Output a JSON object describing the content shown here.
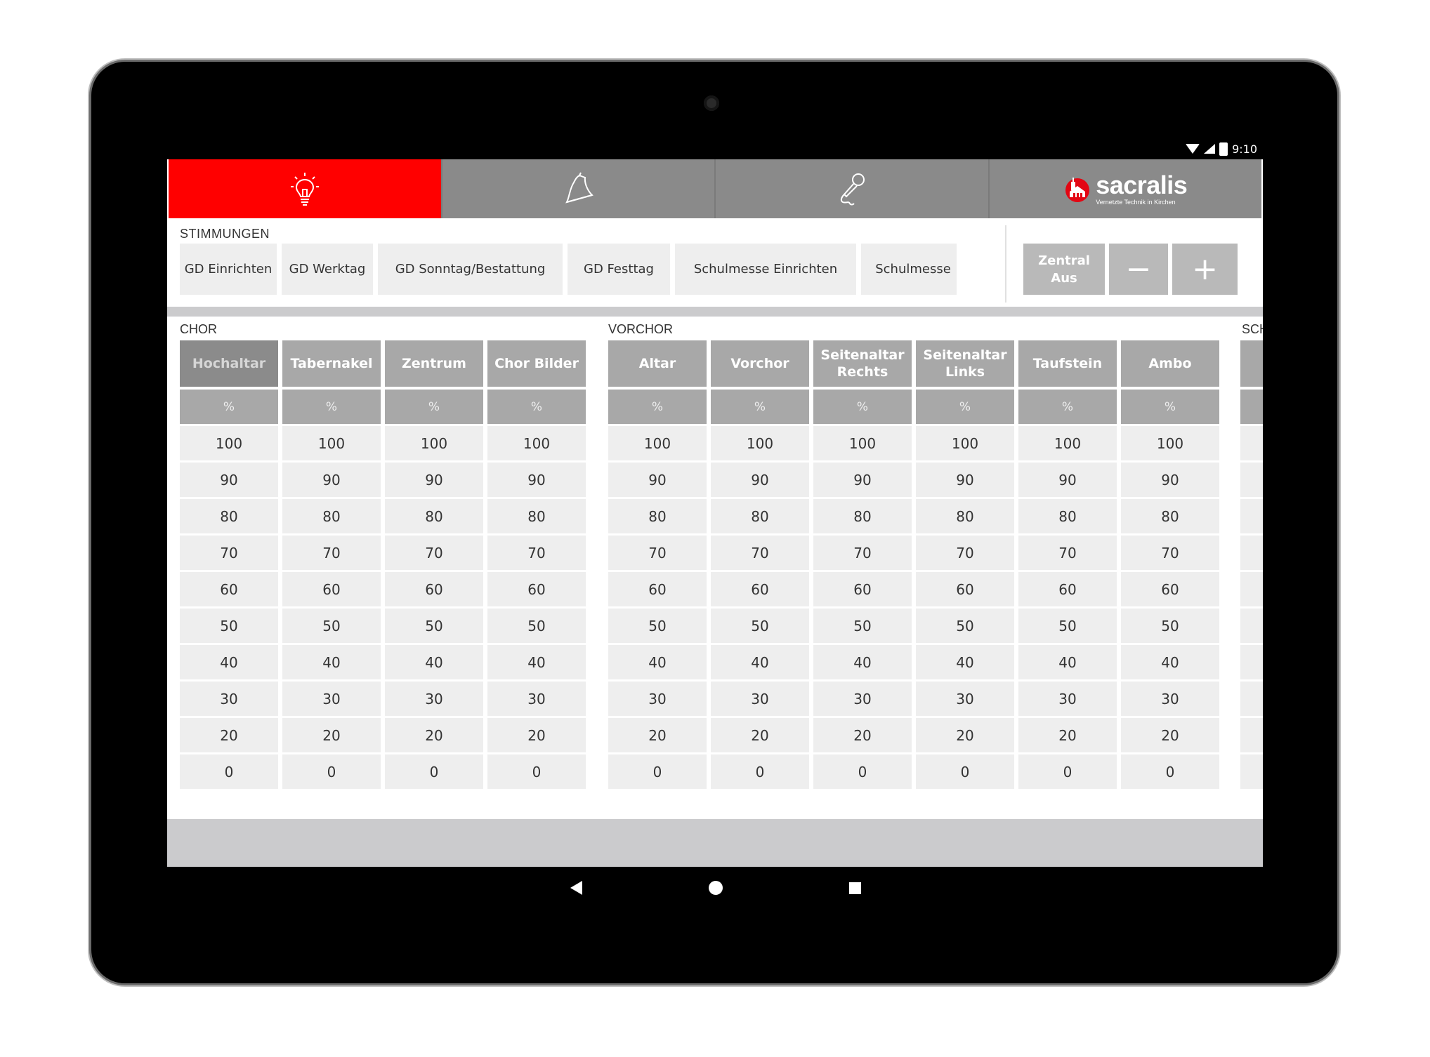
{
  "status": {
    "time": "9:10"
  },
  "nav": {
    "tabs": [
      {
        "name": "light",
        "icon": "lightbulb-icon",
        "active": true
      },
      {
        "name": "bells",
        "icon": "bell-icon",
        "active": false
      },
      {
        "name": "microphone",
        "icon": "microphone-icon",
        "active": false
      },
      {
        "name": "brand",
        "icon": "church-logo-icon",
        "active": false
      }
    ],
    "brand_name": "sacralis",
    "brand_tagline": "Vernetzte Technik in Kirchen"
  },
  "moods": {
    "label": "STIMMUNGEN",
    "items": [
      "GD Einrichten",
      "GD Werktag",
      "GD Sonntag/Bestattung",
      "GD Festtag",
      "Schulmesse Einrichten",
      "Schulmesse"
    ],
    "controls": {
      "zentral_line1": "Zentral",
      "zentral_line2": "Aus",
      "minus": "−",
      "plus": "+"
    }
  },
  "groups": [
    {
      "label": "CHOR",
      "channels": [
        {
          "line1": "Hochaltar",
          "line2": "",
          "selected": true
        },
        {
          "line1": "Tabernakel",
          "line2": ""
        },
        {
          "line1": "Zentrum",
          "line2": ""
        },
        {
          "line1": "Chor Bilder",
          "line2": ""
        }
      ]
    },
    {
      "label": "VORCHOR",
      "channels": [
        {
          "line1": "Altar",
          "line2": ""
        },
        {
          "line1": "Vorchor",
          "line2": ""
        },
        {
          "line1": "Seitenaltar",
          "line2": "Rechts"
        },
        {
          "line1": "Seitenaltar",
          "line2": "Links"
        },
        {
          "line1": "Taufstein",
          "line2": ""
        },
        {
          "line1": "Ambo",
          "line2": ""
        }
      ]
    },
    {
      "label": "SCH",
      "channels": []
    }
  ],
  "unit": "%",
  "levels": [
    "100",
    "90",
    "80",
    "70",
    "60",
    "50",
    "40",
    "30",
    "20",
    "0"
  ],
  "colors": {
    "accent": "#ff0000",
    "tab_grey": "#8a8a8a",
    "header_grey": "#a8a8a8",
    "cell_bg": "#eeeeee"
  }
}
